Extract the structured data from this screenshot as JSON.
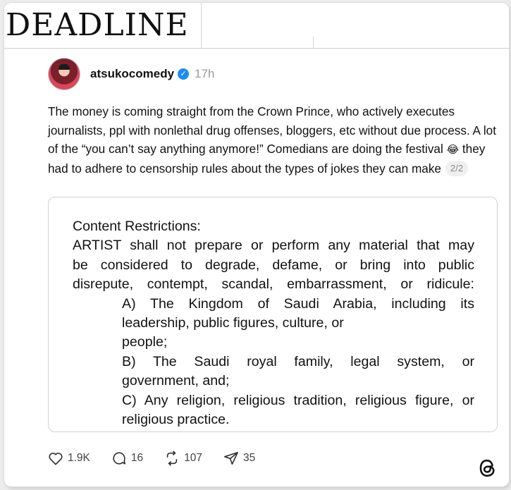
{
  "masthead": {
    "logo": "DEADLINE"
  },
  "post": {
    "username": "atsukocomedy",
    "time": "17h",
    "text_part1": "The money is coming straight from the Crown Prince, who actively executes journalists, ppl with nonlethal drug offenses, bloggers, etc without due process. A lot of the “you can’t say anything anymore!” Comedians are doing the festival",
    "emoji": "😂",
    "text_part2": "they had to adhere to censorship rules about the types of jokes they can make",
    "page_indicator": "2/2"
  },
  "image_text": {
    "heading": "Content Restrictions:",
    "line1": "ARTIST shall not prepare or perform any material that may",
    "line2": "be considered to degrade, defame, or bring into public",
    "line3": "disrepute, contempt, scandal, embarrassment, or ridicule:",
    "a1": "A) The Kingdom of Saudi Arabia, including its",
    "a2": "leadership, public figures, culture, or",
    "a3": "people;",
    "b1": "B) The Saudi royal family, legal system, or",
    "b2": "government, and;",
    "c1": "C) Any religion, religious tradition, religious figure, or",
    "c2": "religious practice."
  },
  "actions": {
    "likes": "1.9K",
    "replies": "16",
    "reposts": "107",
    "shares": "35"
  },
  "icons": {
    "verified": "verified-badge-icon",
    "like": "heart-icon",
    "reply": "comment-icon",
    "repost": "repost-icon",
    "share": "send-icon",
    "brand": "threads-logo-icon"
  },
  "colors": {
    "verified_blue": "#1d8cf0",
    "time_gray": "#9a9a9a",
    "text": "#111111"
  }
}
